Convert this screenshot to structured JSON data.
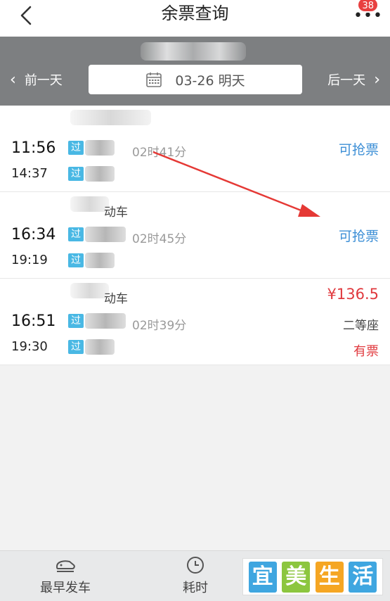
{
  "header": {
    "title": "余票查询",
    "more_dots": "•••",
    "badge_count": "38"
  },
  "datebar": {
    "prev_label": "前一天",
    "next_label": "后一天",
    "date_text": "03-26 明天"
  },
  "trains": [
    {
      "dep_time": "11:56",
      "arr_time": "14:37",
      "dep_tag": "过",
      "arr_tag": "过",
      "duration": "02时41分",
      "status": "可抢票",
      "train_type": ""
    },
    {
      "dep_time": "16:34",
      "arr_time": "19:19",
      "dep_tag": "过",
      "arr_tag": "过",
      "duration": "02时45分",
      "status": "可抢票",
      "train_type": "动车"
    },
    {
      "dep_time": "16:51",
      "arr_time": "19:30",
      "dep_tag": "过",
      "arr_tag": "过",
      "duration": "02时39分",
      "price": "¥136.5",
      "seat_class": "二等座",
      "availability": "有票",
      "train_type": "动车"
    }
  ],
  "bottom_tabs": [
    {
      "label": "最早发车",
      "icon": "train-icon"
    },
    {
      "label": "耗时",
      "icon": "clock-icon"
    }
  ],
  "logo": {
    "chars": [
      "宜",
      "美",
      "生",
      "活"
    ],
    "colors": [
      "#3fa6e0",
      "#8cc63f",
      "#f5a623",
      "#3fa6e0"
    ]
  },
  "colors": {
    "accent_blue": "#3d8fd6",
    "price_red": "#e0393e",
    "tag_blue": "#49b8e4",
    "datebar_gray": "#7d7f81",
    "annotation_arrow": "#e53935"
  }
}
